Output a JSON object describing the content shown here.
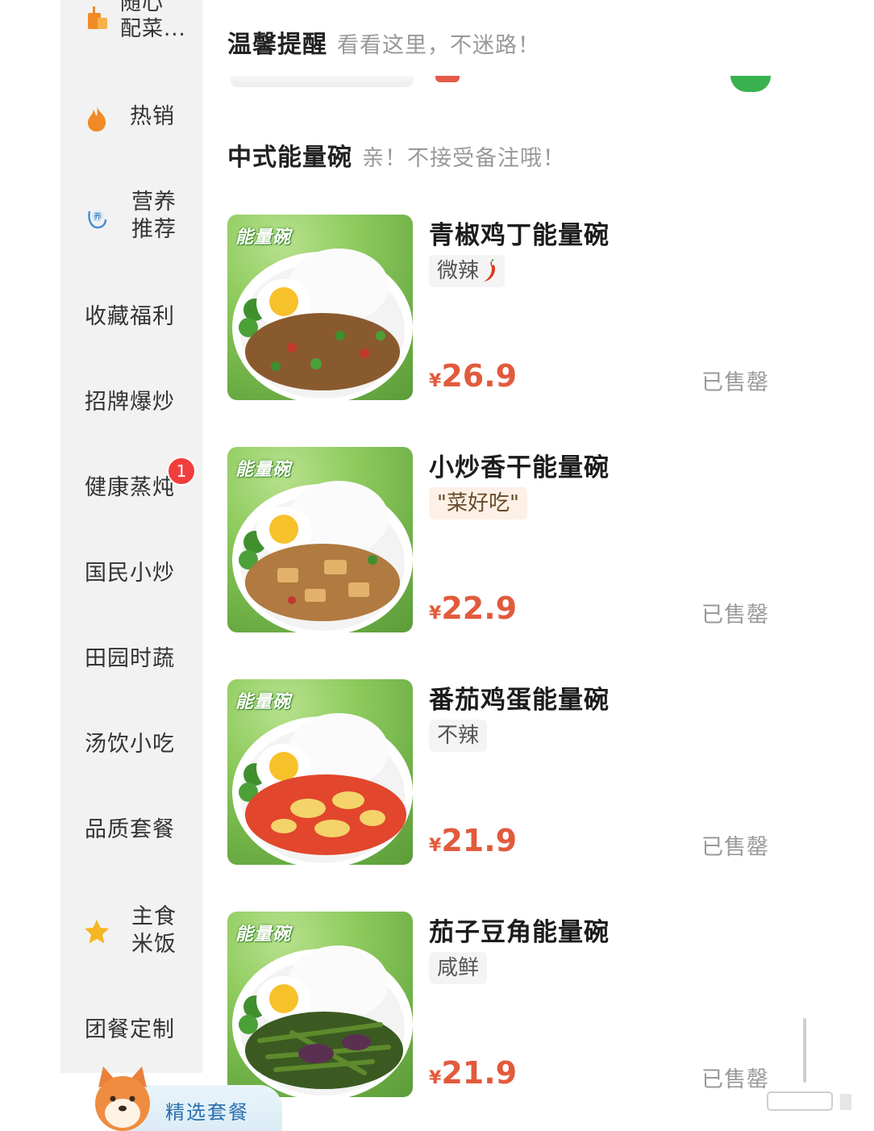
{
  "sidebar": {
    "items": [
      {
        "label": "随心\n配菜...",
        "icon": "cup-icon"
      },
      {
        "label": "热销",
        "icon": "flame-icon"
      },
      {
        "label": "营养\n推荐",
        "icon": "nutrition-icon"
      },
      {
        "label": "收藏福利"
      },
      {
        "label": "招牌爆炒"
      },
      {
        "label": "健康蒸炖",
        "badge": "1"
      },
      {
        "label": "国民小炒"
      },
      {
        "label": "田园时蔬"
      },
      {
        "label": "汤饮小吃"
      },
      {
        "label": "品质套餐"
      },
      {
        "label": "主食\n米饭",
        "icon": "star-icon"
      },
      {
        "label": "团餐定制"
      }
    ]
  },
  "notice": {
    "title": "温馨提醒",
    "subtitle": "看看这里，不迷路！"
  },
  "section": {
    "title": "中式能量碗",
    "subtitle": "亲！不接受备注哦！"
  },
  "products": [
    {
      "name": "青椒鸡丁能量碗",
      "tag": "微辣",
      "tag_icon": "chili-icon",
      "currency": "¥",
      "price": "26.9",
      "status": "已售罄",
      "brand": "能量碗"
    },
    {
      "name": "小炒香干能量碗",
      "tag": "\"菜好吃\"",
      "currency": "¥",
      "price": "22.9",
      "status": "已售罄",
      "brand": "能量碗"
    },
    {
      "name": "番茄鸡蛋能量碗",
      "tag": "不辣",
      "currency": "¥",
      "price": "21.9",
      "status": "已售罄",
      "brand": "能量碗"
    },
    {
      "name": "茄子豆角能量碗",
      "tag": "咸鲜",
      "currency": "¥",
      "price": "21.9",
      "status": "已售罄",
      "brand": "能量碗"
    }
  ],
  "bottom": {
    "label": "精选套餐"
  },
  "colors": {
    "price": "#e25a3c",
    "sidebar_bg": "#f2f2f2",
    "badge": "#f23d3d",
    "thumb_green": "#8fcb5e"
  }
}
